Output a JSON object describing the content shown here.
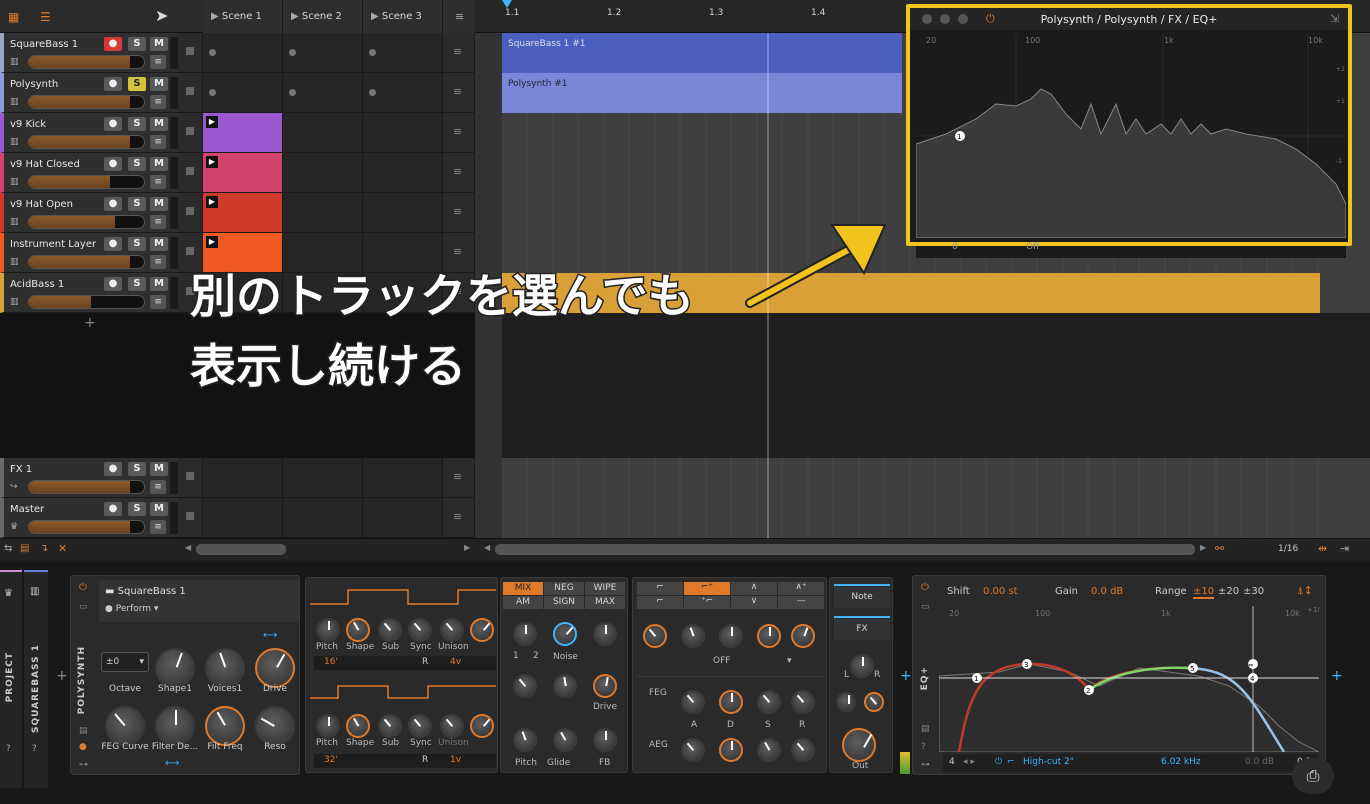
{
  "scenes": [
    "Scene 1",
    "Scene 2",
    "Scene 3"
  ],
  "ruler": [
    "1.1",
    "1.2",
    "1.3",
    "1.4"
  ],
  "tracks": [
    {
      "name": "SquareBass 1",
      "color": "#9aa3c7",
      "mcolor": "#d53b3b",
      "clip": "SquareBass 1 #1"
    },
    {
      "name": "Polysynth",
      "color": "#8e9adb",
      "clip": "Polysynth #1"
    },
    {
      "name": "v9 Kick",
      "color": "#9c58d1"
    },
    {
      "name": "v9 Hat Closed",
      "color": "#d1446e"
    },
    {
      "name": "v9 Hat Open",
      "color": "#cf3a2a"
    },
    {
      "name": "Instrument Layer",
      "color": "#f05a22"
    },
    {
      "name": "AcidBass 1",
      "color": "#d9a038"
    }
  ],
  "fx_tracks": [
    {
      "name": "FX 1"
    },
    {
      "name": "Master"
    }
  ],
  "buttons": {
    "s": "S",
    "m": "M",
    "add": "+"
  },
  "eq_window": {
    "title": "Polysynth / Polysynth / FX / EQ+",
    "freq_labels": [
      "20",
      "100",
      "1k",
      "10k"
    ],
    "point": "1",
    "db_labels": [
      "+3",
      "+2",
      "+1",
      "0",
      "-1",
      "-2",
      "-3"
    ],
    "footer_a": "0",
    "footer_b": "Off"
  },
  "caption": {
    "line1": "別のトラックを選んでも",
    "line2": "表示し続ける"
  },
  "transport": {
    "quant": "1/16"
  },
  "device": {
    "side": [
      "PROJECT",
      "SQUAREBASS 1"
    ],
    "vertical": "POLYSYNTH",
    "preset_name": "SquareBass 1",
    "preset_mode": "Perform",
    "octave_val": "±0",
    "macros": [
      "Octave",
      "Shape1",
      "Voices1",
      "Drive",
      "FEG Curve",
      "Filter De...",
      "Filt Freq",
      "Reso"
    ],
    "osc_labels": [
      "Pitch",
      "Shape",
      "Sub",
      "Sync",
      "Unison"
    ],
    "osc1_vals": [
      "16'",
      "R",
      "4v"
    ],
    "osc2_vals": [
      "32'",
      "R",
      "1v"
    ],
    "mix": [
      "MIX",
      "NEG",
      "WIPE",
      "AM",
      "SIGN",
      "MAX"
    ],
    "mix_labels": [
      "1",
      "2",
      "Noise",
      "Drive",
      "Pitch",
      "Glide",
      "FB"
    ],
    "filter_labels": [
      "OFF"
    ],
    "adsr": [
      "A",
      "D",
      "S",
      "R"
    ],
    "feg": "FEG",
    "aeg": "AEG",
    "note": "Note",
    "fx": "FX",
    "lr": [
      "L",
      "R"
    ],
    "out": "Out",
    "eqplus": "EQ+",
    "eq_shift": "Shift",
    "eq_shift_val": "0.00 st",
    "eq_gain": "Gain",
    "eq_gain_val": "0.0 dB",
    "eq_range": "Range",
    "ranges": [
      "±10",
      "±20",
      "±30"
    ],
    "eq_freq": [
      "20",
      "100",
      "1k",
      "10k"
    ],
    "eq_plus10": "+10",
    "points": [
      "1",
      "2",
      "3",
      "4",
      "5",
      "⇔"
    ],
    "bottom": [
      "4",
      "High-cut 2\"",
      "6.02 kHz",
      "0.0 dB",
      "0.9"
    ]
  }
}
